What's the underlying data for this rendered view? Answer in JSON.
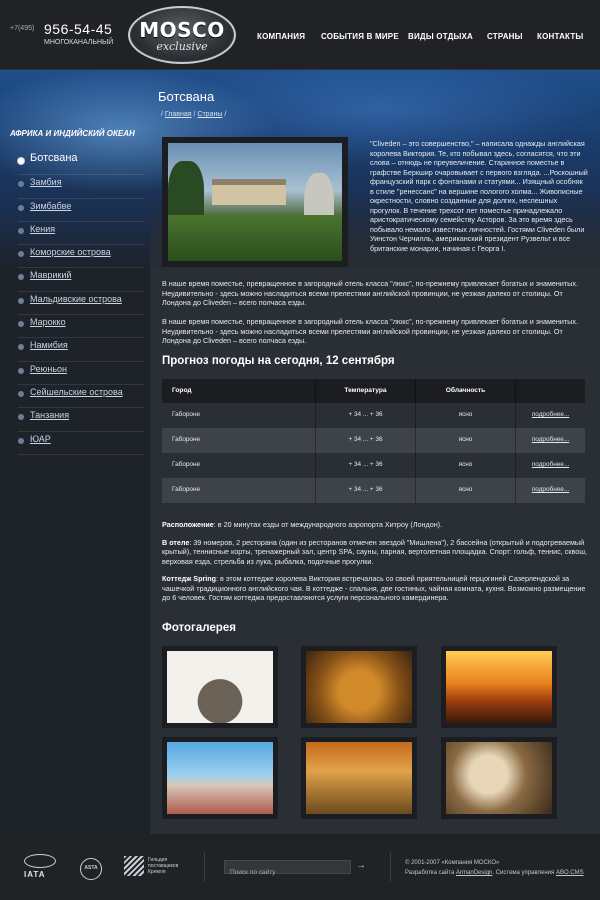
{
  "header": {
    "phone_code": "+7(495)",
    "phone_number": "956-54-45",
    "phone_note": "МНОГОКАНАЛЬНЫЙ",
    "logo_main": "MOSCO",
    "logo_sub": "exclusive",
    "nav": [
      "КОМПАНИЯ",
      "СОБЫТИЯ В МИРЕ",
      "ВИДЫ ОТДЫХА",
      "СТРАНЫ",
      "КОНТАКТЫ"
    ]
  },
  "sidebar": {
    "title": "АФРИКА И ИНДИЙСКИЙ ОКЕАН",
    "items": [
      {
        "label": "Ботсвана",
        "active": true
      },
      {
        "label": "Замбия"
      },
      {
        "label": "Зимбабве"
      },
      {
        "label": "Кения"
      },
      {
        "label": "Коморские острова"
      },
      {
        "label": "Маврикий"
      },
      {
        "label": "Мальдивские острова"
      },
      {
        "label": "Марокко"
      },
      {
        "label": "Намибия"
      },
      {
        "label": "Реюньон"
      },
      {
        "label": "Сейшельские острова"
      },
      {
        "label": "Танзания"
      },
      {
        "label": "ЮАР"
      }
    ]
  },
  "main": {
    "title": "Ботсвана",
    "breadcrumb": [
      "Главная",
      "Страны"
    ],
    "breadcrumb_sep": "/",
    "intro": "\"Cliveden – это совершенство,\" – написала однажды английская королева Виктория. Те, кто побывал здесь, согласятся, что эти слова – отнюдь не преувеличение. Старинное поместье в графстве Беркшир очаровывает с первого взгляда. ...Роскошный французский парк с фонтанами и статуями... Изящный особняк в стиле \"ренессанс\" на вершине пологого холма... Живописные окрестности, словно созданные для долгих, неспешных прогулок. В течение трехсот лет поместье принадлежало аристократическому семейству Асторов. За это время здесь побывало немало известных личностей. Гостями Cliveden были Уинстон Черчилль, американский президент Рузвельт и все британские монархи, начиная с Георга I.",
    "paragraph_1": "В наше время поместье, превращенное в загородный отель класса \"люкс\", по-прежнему привлекает богатых и знаменитых. Неудивительно - здесь можно насладиться всеми прелестями английской провинции, не уезжая далеко от столицы. От Лондона до Cliveden – всего полчаса езды.",
    "paragraph_2": "В наше время поместье, превращенное в загородный отель класса \"люкс\", по-прежнему привлекает богатых и знаменитых. Неудивительно - здесь можно насладиться всеми прелестями английской провинции, не уезжая далеко от столицы. От Лондона до Cliveden – всего полчаса езды.",
    "weather_title": "Прогноз погоды на сегодня, 12 сентября",
    "weather_headers": [
      "Город",
      "Температура",
      "Облачность",
      ""
    ],
    "weather_rows": [
      {
        "city": "Габороне",
        "temp": "+ 34 ... + 36",
        "clouds": "ясно",
        "link": "подробнее..."
      },
      {
        "city": "Габороне",
        "temp": "+ 34 ... + 36",
        "clouds": "ясно",
        "link": "подробнее..."
      },
      {
        "city": "Габороне",
        "temp": "+ 34 ... + 36",
        "clouds": "ясно",
        "link": "подробнее..."
      },
      {
        "city": "Габороне",
        "temp": "+ 34 ... + 36",
        "clouds": "ясно",
        "link": "подробнее..."
      }
    ],
    "location_label": "Расположение",
    "location_text": ": в 20 минутах езды от международного аэропорта Хитроу (Лондон).",
    "hotel_label": "В отеле",
    "hotel_text": ": 39 номеров, 2 ресторана (один из ресторанов отмечен звездой \"Мишлена\"), 2 бассейна (открытый и подогреваемый крытый), теннисные корты, тренажерный зал, центр SPA, сауны, парная, вертолетная площадка. Спорт: гольф, теннис, сквош, верховая езда, стрельба из лука, рыбалка, подочные прогулки.",
    "cottage_label": "Коттедж Spring",
    "cottage_text": ": в этом коттедже королева Виктория встречалась со своей приятельницей герцогиней Сазерлендской за чашечкой традиционного английского чая. В коттедже - спальня, две гостиных, чайная комната, кухня. Возможно размещение до 6 человек. Гостям коттеджа предоставляются услуги персонального камердинера.",
    "gallery_title": "Фотогалерея"
  },
  "footer": {
    "iata": "IATA",
    "asta": "ASTA",
    "kreml": "Гильдия поставщиков Кремля",
    "search_placeholder": "Поиск по сайту",
    "copyright": "© 2001-2007 «Компания МОСКО»",
    "dev_prefix": "Разработка сайта",
    "dev_link": "ArmanDesign",
    "cms_prefix": ". Система управления",
    "cms_link": "ABO.CMS"
  }
}
